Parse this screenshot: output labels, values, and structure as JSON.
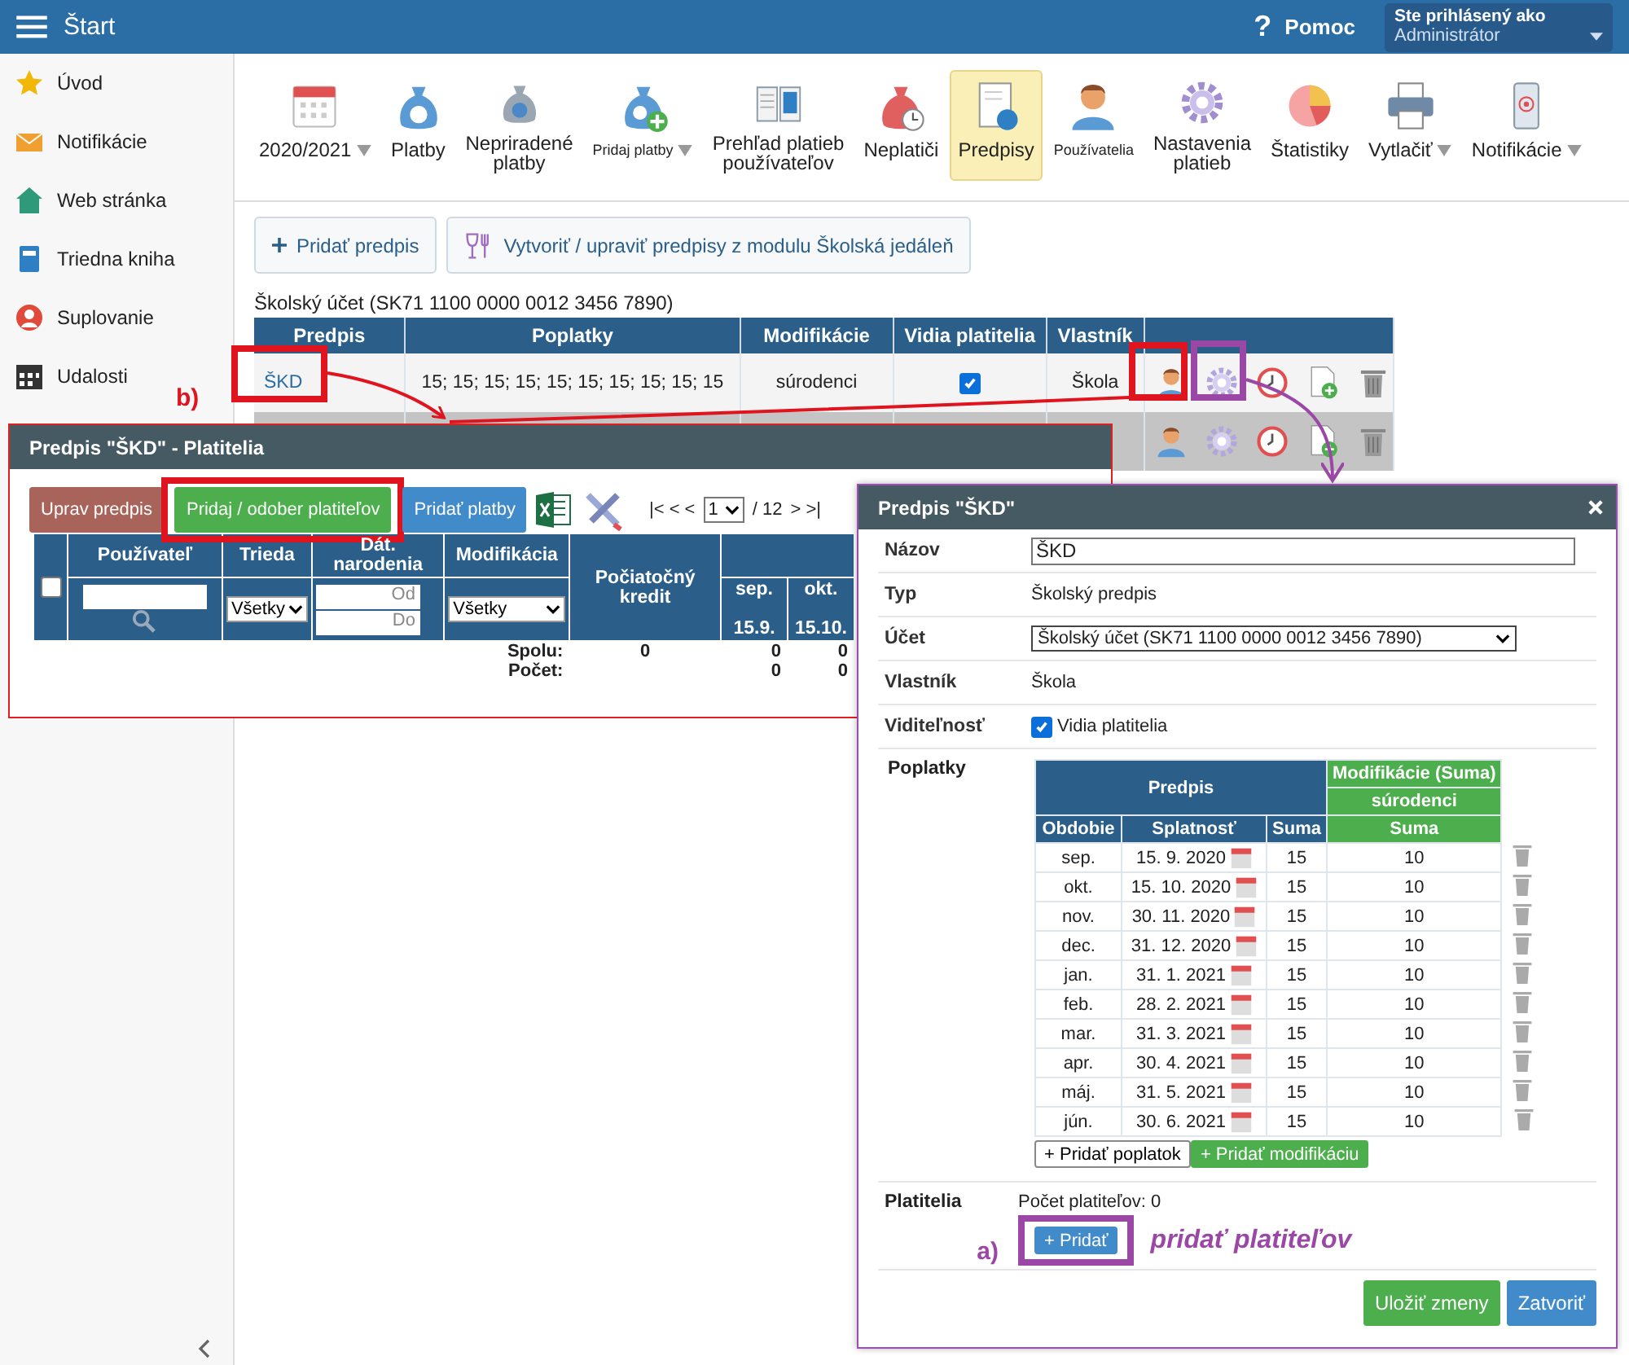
{
  "topbar": {
    "title": "Štart",
    "help_icon": "?",
    "help": "Pomoc",
    "user_caption": "Ste prihlásený ako",
    "user_name": "Administrátor"
  },
  "sidebar": {
    "items": [
      {
        "label": "Úvod"
      },
      {
        "label": "Notifikácie"
      },
      {
        "label": "Web stránka"
      },
      {
        "label": "Triedna kniha"
      },
      {
        "label": "Suplovanie"
      },
      {
        "label": "Udalosti"
      }
    ]
  },
  "toolbar": {
    "items": [
      {
        "label": "2020/2021",
        "kind": "normal",
        "dropdown": true,
        "selected": false
      },
      {
        "label": "Platby",
        "kind": "normal",
        "dropdown": false,
        "selected": false
      },
      {
        "label": "Nepriradené\nplatby",
        "kind": "normal",
        "dropdown": false,
        "selected": false
      },
      {
        "label": "Pridaj platby",
        "kind": "small",
        "dropdown": true,
        "selected": false
      },
      {
        "label": "Prehľad platieb\npoužívateľov",
        "kind": "normal",
        "dropdown": false,
        "selected": false
      },
      {
        "label": "Neplatiči",
        "kind": "normal",
        "dropdown": false,
        "selected": false
      },
      {
        "label": "Predpisy",
        "kind": "normal",
        "dropdown": false,
        "selected": true
      },
      {
        "label": "Používatelia",
        "kind": "small",
        "dropdown": false,
        "selected": false
      },
      {
        "label": "Nastavenia\nplatieb",
        "kind": "normal",
        "dropdown": false,
        "selected": false
      },
      {
        "label": "Štatistiky",
        "kind": "normal",
        "dropdown": false,
        "selected": false
      },
      {
        "label": "Vytlačiť",
        "kind": "normal",
        "dropdown": true,
        "selected": false
      },
      {
        "label": "Notifikácie",
        "kind": "normal",
        "dropdown": true,
        "selected": false
      }
    ]
  },
  "actions": [
    "Pridať predpis",
    "Vytvoriť / upraviť predpisy z modulu Školská jedáleň"
  ],
  "account_label": "Školský účet (SK71 1100 0000 0012 3456 7890)",
  "table": {
    "columns": [
      "Predpis",
      "Poplatky",
      "Modifikácie",
      "Vidia platitelia",
      "Vlastník"
    ],
    "rows": [
      {
        "name": "ŠKD",
        "fees": "15; 15; 15; 15; 15; 15; 15; 15; 15; 15",
        "modifications": "súrodenci",
        "visible": true,
        "owner": "Škola",
        "selected": false
      },
      {
        "selected": true
      }
    ]
  },
  "payers_dialog": {
    "title": "Predpis \"ŠKD\" - Platitelia",
    "buttons": [
      {
        "label": "Uprav predpis",
        "kind": "danger"
      },
      {
        "label": "Pridaj / odober platiteľov",
        "kind": "success"
      },
      {
        "label": "Pridať platby",
        "kind": "info"
      }
    ],
    "select_all": false,
    "pager": {
      "back": "|< < <",
      "page": "1",
      "total": "/ 12",
      "forward": "> >|"
    },
    "columns": [
      "Používateľ",
      "Trieda",
      "Dát. narodenia",
      "Modifikácia",
      "Počiatočný kredit"
    ],
    "filters": {
      "class": "Všetky",
      "birth_from": "Od",
      "birth_to": "Do",
      "modification": "Všetky"
    },
    "months": [
      {
        "label": "sep.",
        "date": "15.9."
      },
      {
        "label": "okt.",
        "date": "15.10."
      }
    ],
    "totals": [
      {
        "label": "Spolu:",
        "credit": "0",
        "months": [
          "0",
          "0"
        ]
      },
      {
        "label": "Počet:",
        "months": [
          "0",
          "0"
        ]
      }
    ]
  },
  "fee_dialog": {
    "title": "Predpis \"ŠKD\"",
    "fields": [
      {
        "label": "Názov",
        "kind": "input",
        "value": "ŠKD"
      },
      {
        "label": "Typ",
        "kind": "text",
        "value": "Školský predpis"
      },
      {
        "label": "Účet",
        "kind": "select",
        "value": "Školský účet (SK71 1100 0000 0012 3456 7890)"
      },
      {
        "label": "Vlastník",
        "kind": "text",
        "value": "Škola"
      },
      {
        "label": "Viditeľnosť",
        "kind": "checkbox",
        "value": "Vidia platitelia",
        "checked": true
      }
    ],
    "fees": {
      "label": "Poplatky",
      "group": "Predpis",
      "mod_group": "Modifikácie (Suma)",
      "mod_name": "súrodenci",
      "columns": [
        "Obdobie",
        "Splatnosť",
        "Suma",
        "Suma"
      ],
      "rows": [
        {
          "period": "sep.",
          "due": "15. 9. 2020",
          "amount": "15",
          "mod": "10"
        },
        {
          "period": "okt.",
          "due": "15. 10. 2020",
          "amount": "15",
          "mod": "10"
        },
        {
          "period": "nov.",
          "due": "30. 11. 2020",
          "amount": "15",
          "mod": "10"
        },
        {
          "period": "dec.",
          "due": "31. 12. 2020",
          "amount": "15",
          "mod": "10"
        },
        {
          "period": "jan.",
          "due": "31. 1. 2021",
          "amount": "15",
          "mod": "10"
        },
        {
          "period": "feb.",
          "due": "28. 2. 2021",
          "amount": "15",
          "mod": "10"
        },
        {
          "period": "mar.",
          "due": "31. 3. 2021",
          "amount": "15",
          "mod": "10"
        },
        {
          "period": "apr.",
          "due": "30. 4. 2021",
          "amount": "15",
          "mod": "10"
        },
        {
          "period": "máj.",
          "due": "31. 5. 2021",
          "amount": "15",
          "mod": "10"
        },
        {
          "period": "jún.",
          "due": "30. 6. 2021",
          "amount": "15",
          "mod": "10"
        }
      ],
      "add_fee": "+ Pridať poplatok",
      "add_mod": "+ Pridať modifikáciu"
    },
    "payers": {
      "label": "Platitelia",
      "count": "Počet platiteľov: 0",
      "add": "+ Pridať"
    },
    "buttons": [
      {
        "label": "Uložiť zmeny",
        "kind": "success"
      },
      {
        "label": "Zatvoriť",
        "kind": "info"
      }
    ]
  },
  "annotations": {
    "a": "a)",
    "b": "b)",
    "hint": "pridať platiteľov"
  }
}
